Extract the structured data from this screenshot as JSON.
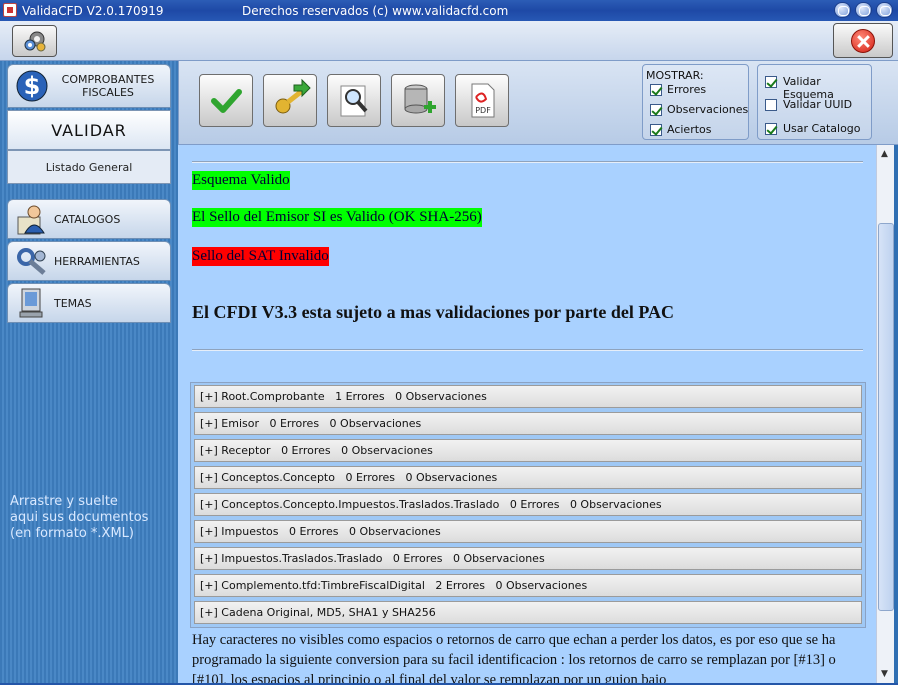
{
  "window": {
    "title": "ValidaCFD V2.0.170919",
    "subtitle": "Derechos reservados (c) www.validacfd.com"
  },
  "sidebar": {
    "comprobantes_label": "COMPROBANTES FISCALES",
    "validar_label": "VALIDAR",
    "listado_label": "Listado General",
    "items": [
      {
        "label": "CATALOGOS",
        "icon": "user-card-icon"
      },
      {
        "label": "HERRAMIENTAS",
        "icon": "tools-icon"
      },
      {
        "label": "TEMAS",
        "icon": "monitor-icon"
      }
    ],
    "drop_hint": "Arrastre y suelte\naqui sus documentos\n(en formato *.XML)"
  },
  "toolbar": {
    "buttons": [
      "validate-check-icon",
      "key-import-icon",
      "search-icon",
      "database-add-icon",
      "pdf-icon"
    ],
    "pdf_text": "PDF",
    "mostrar": {
      "title": "MOSTRAR:",
      "options": [
        {
          "label": "Errores",
          "checked": true
        },
        {
          "label": "Observaciones",
          "checked": true
        },
        {
          "label": "Aciertos",
          "checked": true
        }
      ]
    },
    "validation": {
      "options": [
        {
          "label": "Validar Esquema",
          "checked": true
        },
        {
          "label": "Validar UUID",
          "checked": false
        },
        {
          "label": "Usar Catalogo",
          "checked": true
        }
      ]
    }
  },
  "results": {
    "messages": [
      {
        "text": "Esquema Valido",
        "status": "ok",
        "color": "#00ff00"
      },
      {
        "text": "El Sello del Emisor SI es Valido (OK SHA-256)",
        "status": "ok",
        "color": "#00ff00"
      },
      {
        "text": "Sello del SAT Invalido",
        "status": "error",
        "color": "#ff0000"
      }
    ],
    "headline": "El CFDI V3.3 esta sujeto a mas validaciones por parte del PAC",
    "sections": [
      "[+] Root.Comprobante   1 Errores   0 Observaciones",
      "[+] Emisor   0 Errores   0 Observaciones",
      "[+] Receptor   0 Errores   0 Observaciones",
      "[+] Conceptos.Concepto   0 Errores   0 Observaciones",
      "[+] Conceptos.Concepto.Impuestos.Traslados.Traslado   0 Errores   0 Observaciones",
      "[+] Impuestos   0 Errores   0 Observaciones",
      "[+] Impuestos.Traslados.Traslado   0 Errores   0 Observaciones",
      "[+] Complemento.tfd:TimbreFiscalDigital   2 Errores   0 Observaciones",
      "[+] Cadena Original, MD5, SHA1 y SHA256"
    ],
    "footer": "Hay caracteres no visibles como espacios o retornos de carro que echan a perder los datos, es por eso que se ha programado la siguiente conversion para su facil identificacion : los retornos de carro se remplazan por [#13] o [#10], los espacios al principio o al final del valor se remplazan por un guion bajo"
  },
  "colors": {
    "content_bg": "#a9d1ff",
    "sidebar_bg": "#3b79b8",
    "ok": "#00ff00",
    "error": "#ff0000"
  }
}
